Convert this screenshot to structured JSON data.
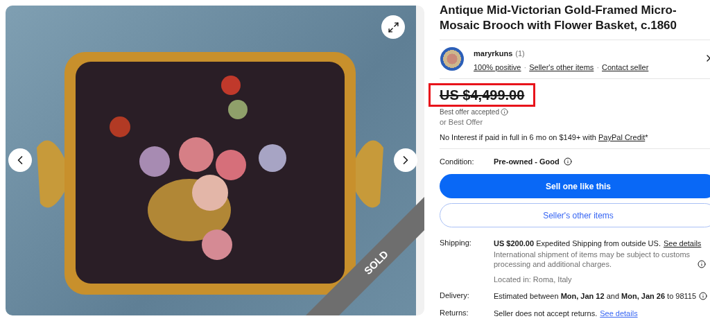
{
  "photo": {
    "badge": "SOLD"
  },
  "title": "Antique Mid-Victorian Gold-Framed Micro-Mosaic Brooch with Flower Basket, c.1860",
  "seller": {
    "name": "maryrkuns",
    "count": "(1)",
    "separator": "·",
    "links": [
      "100% positive",
      "Seller's other items",
      "Contact seller"
    ]
  },
  "price": {
    "amount": "US $4,499.00",
    "struck": true,
    "highlighted": true,
    "note": "Best offer accepted",
    "alt": "or Best Offer"
  },
  "financing": {
    "text": "No Interest if paid in full in 6 mo on $149+ with",
    "link": "PayPal Credit",
    "mark": "*"
  },
  "condition": {
    "label": "Condition:",
    "value": "Pre-owned - Good",
    "info": true
  },
  "buttons": [
    {
      "label": "Sell one like this",
      "kind": "primary"
    },
    {
      "label": "Seller's other items",
      "kind": "secondary"
    }
  ],
  "details": [
    {
      "label": "Shipping:",
      "text": "**US $200.00** Expedited Shipping from outside US.",
      "link": "See details",
      "info": false,
      "notes": [
        {
          "text": "International shipment of items may be subject to customs processing and additional charges.",
          "info": true
        },
        {
          "text": "Located in: Roma, Italy",
          "info": false
        }
      ]
    },
    {
      "label": "Delivery:",
      "text": "Estimated between **Mon, Jan 12** and **Mon, Jan 26** to 98115",
      "info": true
    },
    {
      "label": "Returns:",
      "text": "Seller does not accept returns.",
      "link": "See details",
      "info": false
    }
  ]
}
